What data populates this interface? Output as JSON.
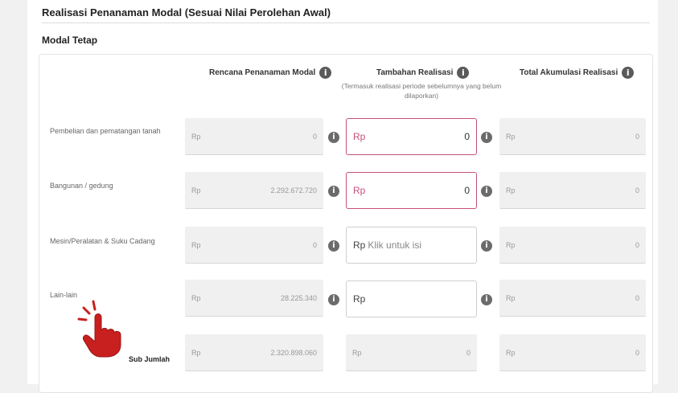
{
  "section_title": "Realisasi Penanaman Modal (Sesuai Nilai Perolehan Awal)",
  "subtitle": "Modal Tetap",
  "columns": {
    "plan": "Rencana Penanaman Modal",
    "addition": "Tambahan Realisasi",
    "addition_note": "(Termasuk realisasi periode sebelumnya yang belum dilaporkan)",
    "total": "Total Akumulasi Realisasi"
  },
  "currency": "Rp",
  "info_glyph": "i",
  "rows": [
    {
      "label": "Pembelian dan pematangan tanah",
      "plan": "0",
      "addition": "0",
      "addition_placeholder": "",
      "total": "0"
    },
    {
      "label": "Bangunan / gedung",
      "plan": "2.292.672.720",
      "addition": "0",
      "addition_placeholder": "",
      "total": "0"
    },
    {
      "label": "Mesin/Peralatan & Suku Cadang",
      "plan": "0",
      "addition": "",
      "addition_placeholder": "Klik untuk isi",
      "total": "0"
    },
    {
      "label": "Lain-lain",
      "plan": "28.225.340",
      "addition": "",
      "addition_placeholder": "",
      "total": "0"
    }
  ],
  "subtotal": {
    "label": "Sub Jumlah",
    "plan": "2.320.898.060",
    "addition": "0",
    "total": "0"
  },
  "colors": {
    "accent": "#c6507c",
    "hand": "#c8201f"
  },
  "icons": {
    "info": "info-icon",
    "pointer": "pointing-hand-icon"
  }
}
